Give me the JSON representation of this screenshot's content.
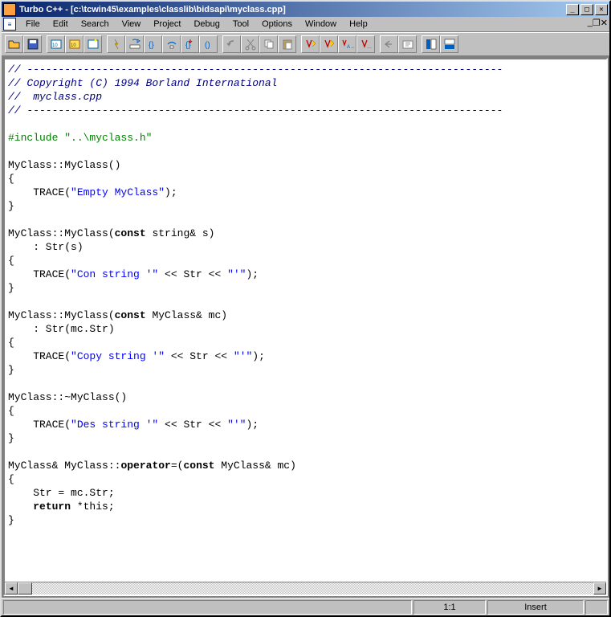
{
  "title": "Turbo C++ - [c:\\tcwin45\\examples\\classlib\\bidsapi\\myclass.cpp]",
  "menu": {
    "file": "File",
    "edit": "Edit",
    "search": "Search",
    "view": "View",
    "project": "Project",
    "debug": "Debug",
    "tool": "Tool",
    "options": "Options",
    "window": "Window",
    "help": "Help"
  },
  "status": {
    "pos": "1:1",
    "mode": "Insert"
  },
  "code": {
    "dash_open": "// ----------------------------------------------------------------------------",
    "copy": "// Copyright (C) 1994 Borland International",
    "fname": "//  myclass.cpp",
    "dash_close": "// ----------------------------------------------------------------------------",
    "include_pp": "#include ",
    "include_s": "\"..\\myclass.h\"",
    "ctor0": "MyClass::MyClass()",
    "ob": "{",
    "cb": "}",
    "trace_open": "    TRACE(",
    "trace_close": ");",
    "empty": "\"Empty MyClass\"",
    "ctor1_a": "MyClass::MyClass(",
    "const": "const",
    "ctor1_b": " string& s)",
    "init1": "    : Str(s)",
    "con_a": "\"Con string '\"",
    "shl": " << Str << ",
    "tick": "\"'\"",
    "ctor2_b": " MyClass& mc)",
    "init2": "    : Str(mc.Str)",
    "copy_a": "\"Copy string '\"",
    "dtor": "MyClass::~MyClass()",
    "des_a": "\"Des string '\"",
    "op_a": "MyClass& MyClass::",
    "op_kw": "operator",
    "op_b": "=(",
    "op_c": " MyClass& mc)",
    "assign": "    Str = mc.Str;",
    "ret_a": "    ",
    "ret_kw": "return",
    "ret_b": " *this;"
  }
}
